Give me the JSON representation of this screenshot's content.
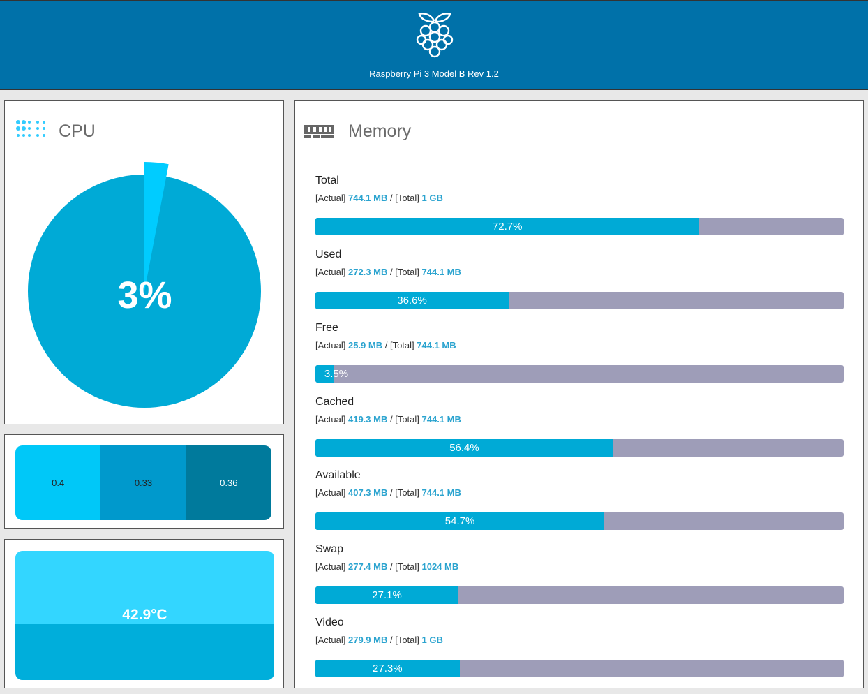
{
  "header": {
    "title": "Raspberry Pi 3 Model B Rev 1.2",
    "logo_icon": "raspberry-logo-icon"
  },
  "cpu": {
    "title": "CPU",
    "icon": "cpu-icon",
    "usage_label": "3%",
    "usage_percent": 3
  },
  "load": {
    "values": [
      "0.4",
      "0.33",
      "0.36"
    ]
  },
  "temperature": {
    "label": "42.9°C"
  },
  "memory": {
    "title": "Memory",
    "icon": "memory-icon",
    "items": [
      {
        "name": "Total",
        "actual_tag": "[Actual]",
        "actual": "744.1 MB",
        "sep": " / ",
        "total_tag": "[Total]",
        "total": "1 GB",
        "percent_label": "72.7%",
        "percent": 72.7
      },
      {
        "name": "Used",
        "actual_tag": "[Actual]",
        "actual": "272.3 MB",
        "sep": " / ",
        "total_tag": "[Total]",
        "total": "744.1 MB",
        "percent_label": "36.6%",
        "percent": 36.6
      },
      {
        "name": "Free",
        "actual_tag": "[Actual]",
        "actual": "25.9 MB",
        "sep": " / ",
        "total_tag": "[Total]",
        "total": "744.1 MB",
        "percent_label": "3.5%",
        "percent": 3.5
      },
      {
        "name": "Cached",
        "actual_tag": "[Actual]",
        "actual": "419.3 MB",
        "sep": " / ",
        "total_tag": "[Total]",
        "total": "744.1 MB",
        "percent_label": "56.4%",
        "percent": 56.4
      },
      {
        "name": "Available",
        "actual_tag": "[Actual]",
        "actual": "407.3 MB",
        "sep": " / ",
        "total_tag": "[Total]",
        "total": "744.1 MB",
        "percent_label": "54.7%",
        "percent": 54.7
      },
      {
        "name": "Swap",
        "actual_tag": "[Actual]",
        "actual": "277.4 MB",
        "sep": " / ",
        "total_tag": "[Total]",
        "total": "1024 MB",
        "percent_label": "27.1%",
        "percent": 27.1
      },
      {
        "name": "Video",
        "actual_tag": "[Actual]",
        "actual": "279.9 MB",
        "sep": " / ",
        "total_tag": "[Total]",
        "total": "1 GB",
        "percent_label": "27.3%",
        "percent": 27.3
      }
    ]
  },
  "colors": {
    "header_bg": "#0071a9",
    "accent": "#00aad6",
    "bar_track": "#9e9db8",
    "pie_slice": "#00ccff"
  }
}
